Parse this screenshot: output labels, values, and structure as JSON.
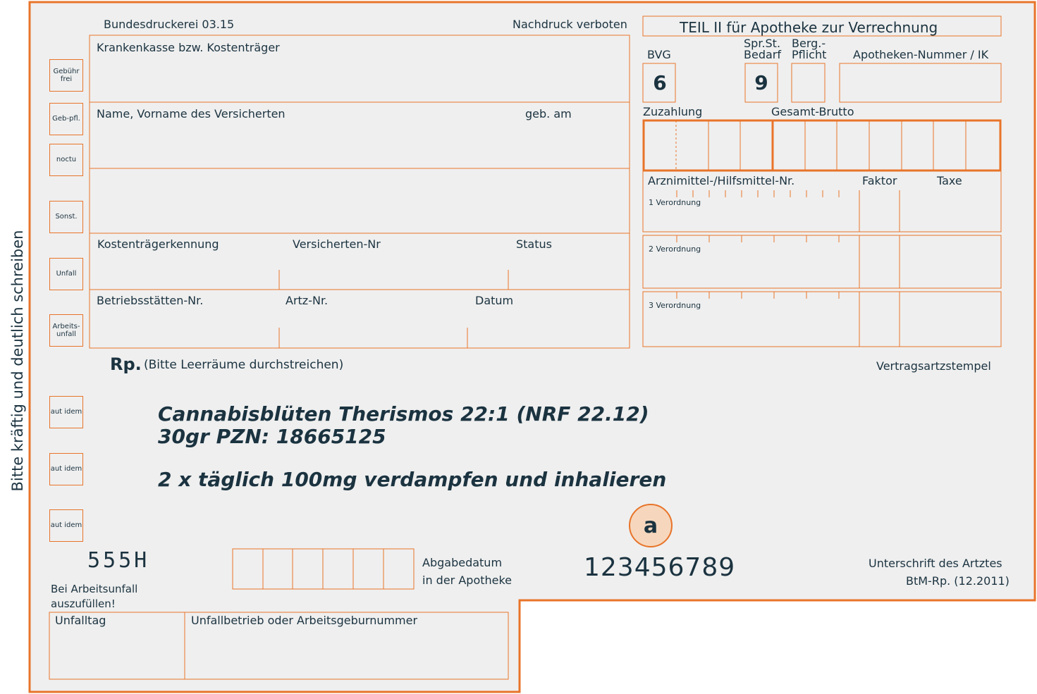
{
  "vertical_note": "Bitte kräftig und deutlich schreiben",
  "header": {
    "printer": "Bundesdruckerei 03.15",
    "reprint": "Nachdruck verboten",
    "teil2": "TEIL II für Apotheke zur Verrechnung"
  },
  "side_boxes": {
    "gebuehr_frei": "Gebühr frei",
    "geb_pfl": "Geb-pfl.",
    "noctu": "noctu",
    "sonst": "Sonst.",
    "unfall": "Unfall",
    "arbeitsunfall": "Arbeits-unfall",
    "aut_idem": "aut idem"
  },
  "patient": {
    "kasse": "Krankenkasse bzw. Kostenträger",
    "name": "Name, Vorname des Versicherten",
    "geb": "geb. am",
    "kostentraeger": "Kostenträgerkennung",
    "versicherten_nr": "Versicherten-Nr",
    "status": "Status",
    "betriebsstaette": "Betriebsstätten-Nr.",
    "arzt_nr": "Artz-Nr.",
    "datum": "Datum"
  },
  "pharmacy": {
    "bvg": "BVG",
    "bvg_value": "6",
    "sprst": "Spr.St. Bedarf",
    "sprst_value": "9",
    "berg": "Berg.- Pflicht",
    "apotheke": "Apotheken-Nummer / IK",
    "zuzahlung": "Zuzahlung",
    "gesamt": "Gesamt-Brutto",
    "arznei": "Arznimittel-/Hilfsmittel-Nr.",
    "faktor": "Faktor",
    "taxe": "Taxe",
    "v1": "1 Verordnung",
    "v2": "2 Verordnung",
    "v3": "3 Verordnung"
  },
  "rx": {
    "symbol": "Rp.",
    "hint": "(Bitte Leerräume durchstreichen)",
    "stamp": "Vertragsartzstempel",
    "line1": "Cannabisblüten Therismos 22:1 (NRF 22.12)",
    "line2": "30gr PZN: 18665125",
    "line3": "2 x täglich 100mg verdampfen und inhalieren"
  },
  "footer": {
    "code": "555H",
    "abgabe_line1": "Abgabedatum",
    "abgabe_line2": "in der Apotheke",
    "circle": "a",
    "number": "123456789",
    "signature": "Unterschrift des Artztes",
    "form_id": "BtM-Rp. (12.2011)",
    "arbeitsunfall_line1": "Bei Arbeitsunfall",
    "arbeitsunfall_line2": "auszufüllen!",
    "unfalltag": "Unfalltag",
    "unfallbetrieb": "Unfallbetrieb oder Arbeitsgeburnummer"
  },
  "colors": {
    "form_bg": "#efefef",
    "accent": "#e8742a",
    "ink": "#1b3340"
  }
}
